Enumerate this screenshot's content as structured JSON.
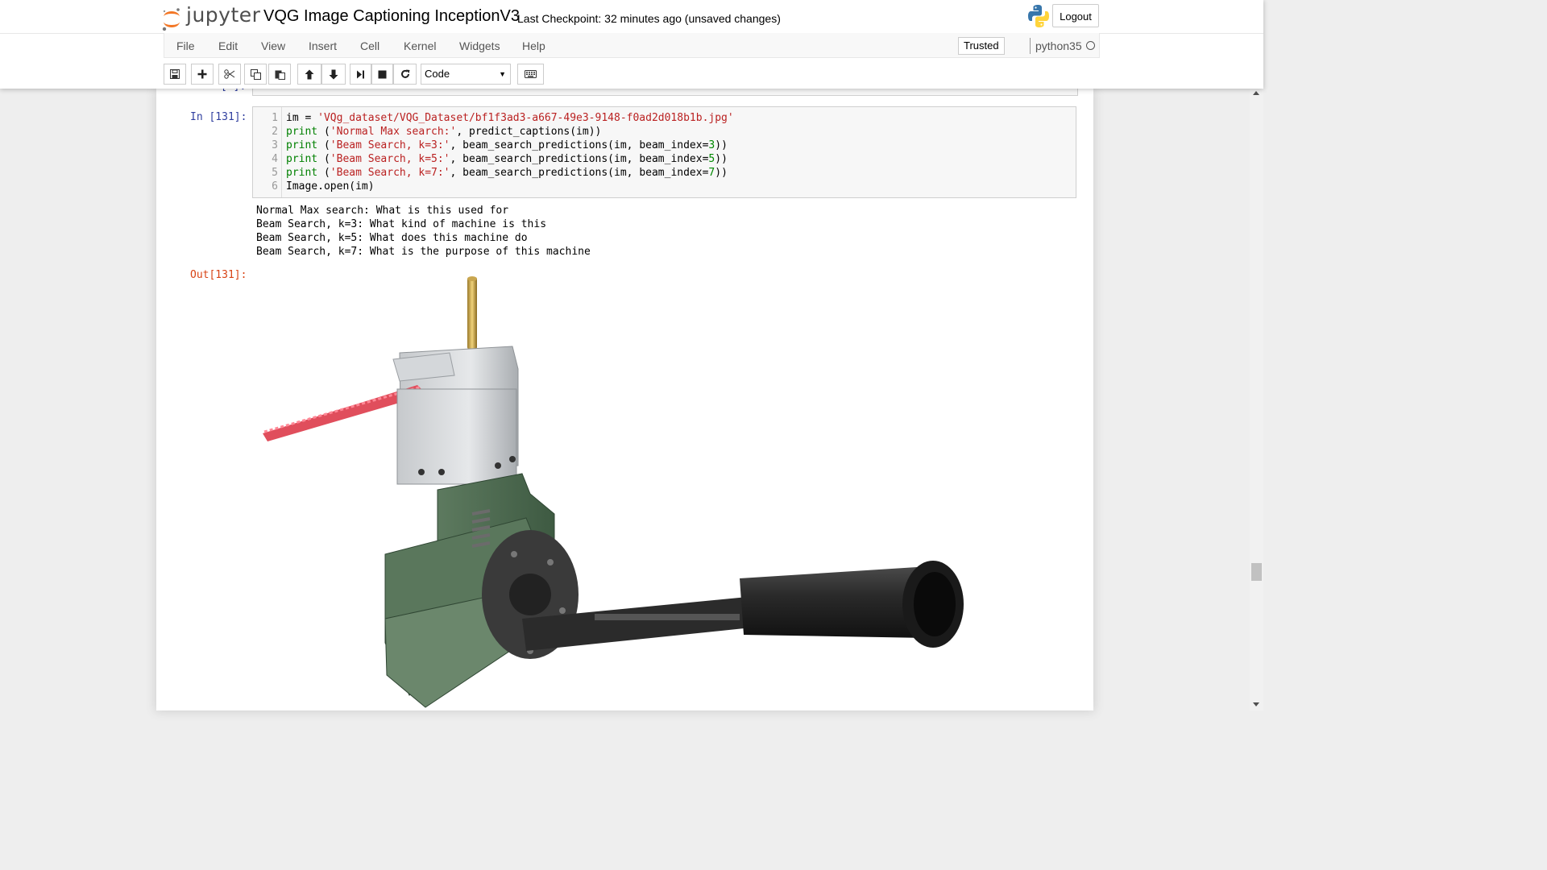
{
  "app": {
    "logo_text": "jupyter",
    "notebook_title": "VQG Image Captioning InceptionV3",
    "checkpoint": "Last Checkpoint: 32 minutes ago (unsaved changes)",
    "logout_label": "Logout"
  },
  "menu": {
    "items": [
      "File",
      "Edit",
      "View",
      "Insert",
      "Cell",
      "Kernel",
      "Widgets",
      "Help"
    ],
    "trusted_label": "Trusted",
    "kernel_name": "python35"
  },
  "toolbar": {
    "buttons": [
      "save-icon",
      "plus-icon",
      "cut-icon",
      "copy-icon",
      "paste-icon",
      "arrow-up-icon",
      "arrow-down-icon",
      "step-forward-icon",
      "stop-icon",
      "restart-icon",
      "keyboard-icon"
    ],
    "cell_type": "Code"
  },
  "cell": {
    "prev_prompt": "[ ]:",
    "in_prompt": "In [131]:",
    "out_prompt": "Out[131]:",
    "line_numbers": [
      "1",
      "2",
      "3",
      "4",
      "5",
      "6"
    ],
    "code": {
      "l1_var": "im = ",
      "l1_str": "'VQg_dataset/VQG_Dataset/bf1f3ad3-a667-49e3-9148-f0ad2d018b1b.jpg'",
      "print": "print",
      "l2_str": "'Normal Max search:'",
      "l2_rest": ", predict_captions(im))",
      "l3_str": "'Beam Search, k=3:'",
      "l3_rest": ", beam_search_predictions(im, beam_index=",
      "l3_num": "3",
      "l4_str": "'Beam Search, k=5:'",
      "l4_num": "5",
      "l5_str": "'Beam Search, k=7:'",
      "l5_num": "7",
      "open_paren": " (",
      "close_parens": "))",
      "l6": "Image.open(im)"
    },
    "stdout": [
      "Normal Max search: What is this used for",
      "Beam Search, k=3: What kind of machine is this",
      "Beam Search, k=5: What does this machine do",
      "Beam Search, k=7: What is the purpose of this machine"
    ]
  },
  "colors": {
    "in_prompt": "#303f9f",
    "out_prompt": "#d84315",
    "keyword": "#008000",
    "string": "#ba2121",
    "logo_orange": "#f37726"
  }
}
